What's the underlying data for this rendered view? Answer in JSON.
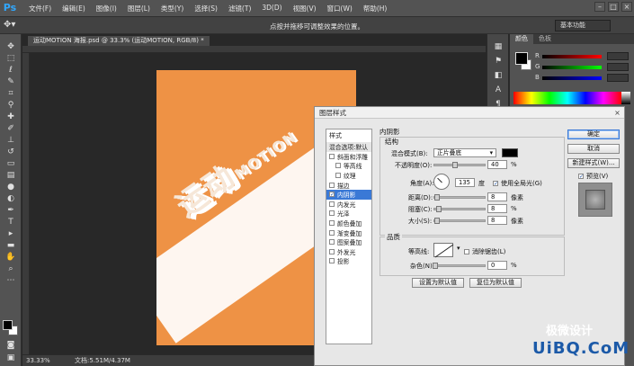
{
  "app": {
    "logo": "Ps",
    "menu": [
      "文件(F)",
      "编辑(E)",
      "图像(I)",
      "图层(L)",
      "类型(Y)",
      "选择(S)",
      "滤镜(T)",
      "3D(D)",
      "视图(V)",
      "窗口(W)",
      "帮助(H)"
    ],
    "window_controls": [
      "–",
      "□",
      "×"
    ]
  },
  "options_bar": {
    "hint": "点按并拖移可调整效果的位置。",
    "workspace": "基本功能"
  },
  "document": {
    "tab_title": "运动MOTION 海报.psd @ 33.3% (运动MOTION, RGB/8) *",
    "poster_cn": "运动",
    "poster_en": "MOTION",
    "canvas_color": "#ee9245"
  },
  "status_bar": {
    "zoom": "33.33%",
    "doc_info": "文档:5.51M/4.37M"
  },
  "color_panel": {
    "tabs": [
      "颜色",
      "色板"
    ],
    "sliders": [
      {
        "label": "R",
        "gradient": [
          "#000000",
          "#ff0000"
        ]
      },
      {
        "label": "G",
        "gradient": [
          "#000000",
          "#00ff00"
        ]
      },
      {
        "label": "B",
        "gradient": [
          "#000000",
          "#0000ff"
        ]
      }
    ]
  },
  "dialog": {
    "title": "图层样式",
    "close": "×",
    "styles_header": "样式",
    "styles": [
      {
        "label": "混合选项:默认",
        "checkbox": false,
        "indent": false,
        "selected": false,
        "plain": true
      },
      {
        "label": "斜面和浮雕",
        "checkbox": true,
        "checked": false,
        "indent": false
      },
      {
        "label": "等高线",
        "checkbox": true,
        "checked": false,
        "indent": true
      },
      {
        "label": "纹理",
        "checkbox": true,
        "checked": false,
        "indent": true
      },
      {
        "label": "描边",
        "checkbox": true,
        "checked": false,
        "indent": false
      },
      {
        "label": "内阴影",
        "checkbox": true,
        "checked": true,
        "indent": false,
        "selected": true
      },
      {
        "label": "内发光",
        "checkbox": true,
        "checked": false,
        "indent": false
      },
      {
        "label": "光泽",
        "checkbox": true,
        "checked": false,
        "indent": false
      },
      {
        "label": "颜色叠加",
        "checkbox": true,
        "checked": false,
        "indent": false
      },
      {
        "label": "渐变叠加",
        "checkbox": true,
        "checked": false,
        "indent": false
      },
      {
        "label": "图案叠加",
        "checkbox": true,
        "checked": false,
        "indent": false
      },
      {
        "label": "外发光",
        "checkbox": true,
        "checked": false,
        "indent": false
      },
      {
        "label": "投影",
        "checkbox": true,
        "checked": false,
        "indent": false
      }
    ],
    "section_title": "内阴影",
    "structure_title": "结构",
    "blend_mode_label": "混合模式(B):",
    "blend_mode_value": "正片叠底",
    "shadow_color": "#000000",
    "opacity_label": "不透明度(O):",
    "opacity_value": "40",
    "opacity_unit": "%",
    "opacity_fraction": 0.4,
    "angle_label": "角度(A):",
    "angle_value": "135",
    "angle_unit": "度",
    "global_light_label": "使用全局光(G)",
    "global_light_checked": true,
    "distance_label": "距离(D):",
    "distance_value": "8",
    "distance_unit": "像素",
    "choke_label": "阻塞(C):",
    "choke_value": "8",
    "choke_unit": "%",
    "size_label": "大小(S):",
    "size_value": "8",
    "size_unit": "像素",
    "quality_title": "品质",
    "contour_label": "等高线:",
    "antialias_label": "消除锯齿(L)",
    "noise_label": "杂色(N):",
    "noise_value": "0",
    "noise_unit": "%",
    "set_default_btn": "设置为默认值",
    "reset_default_btn": "复位为默认值",
    "ok_btn": "确定",
    "cancel_btn": "取消",
    "new_style_btn": "新建样式(W)...",
    "preview_label": "预览(V)",
    "preview_checked": true
  },
  "watermark": {
    "brand": "极微设计",
    "site": "UiBQ.CoM"
  }
}
